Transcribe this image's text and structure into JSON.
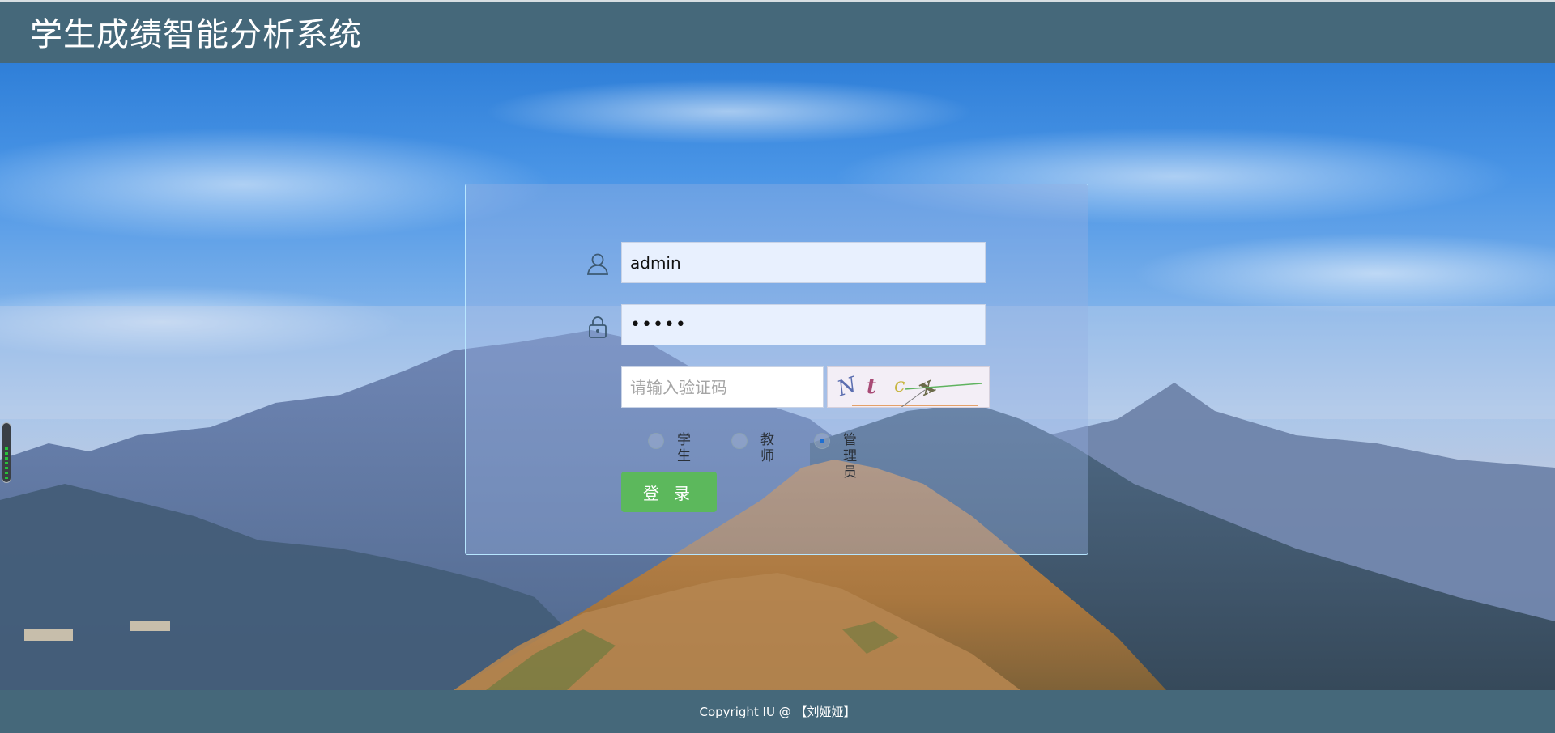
{
  "header": {
    "title": "学生成绩智能分析系统"
  },
  "login": {
    "username_value": "admin",
    "password_value": "•••••",
    "captcha_placeholder": "请输入验证码",
    "captcha_chars": [
      "N",
      "t",
      "c",
      "x"
    ],
    "roles": [
      {
        "label": "学生",
        "checked": false
      },
      {
        "label": "教师",
        "checked": false
      },
      {
        "label": "管理员",
        "checked": true
      }
    ],
    "submit_label": "登录"
  },
  "footer": {
    "copyright": "Copyright   IU @ 【刘娅娅】"
  },
  "colors": {
    "header_bg": "#45687a",
    "login_button": "#5cb85c",
    "panel_border": "#b7e6ff"
  }
}
